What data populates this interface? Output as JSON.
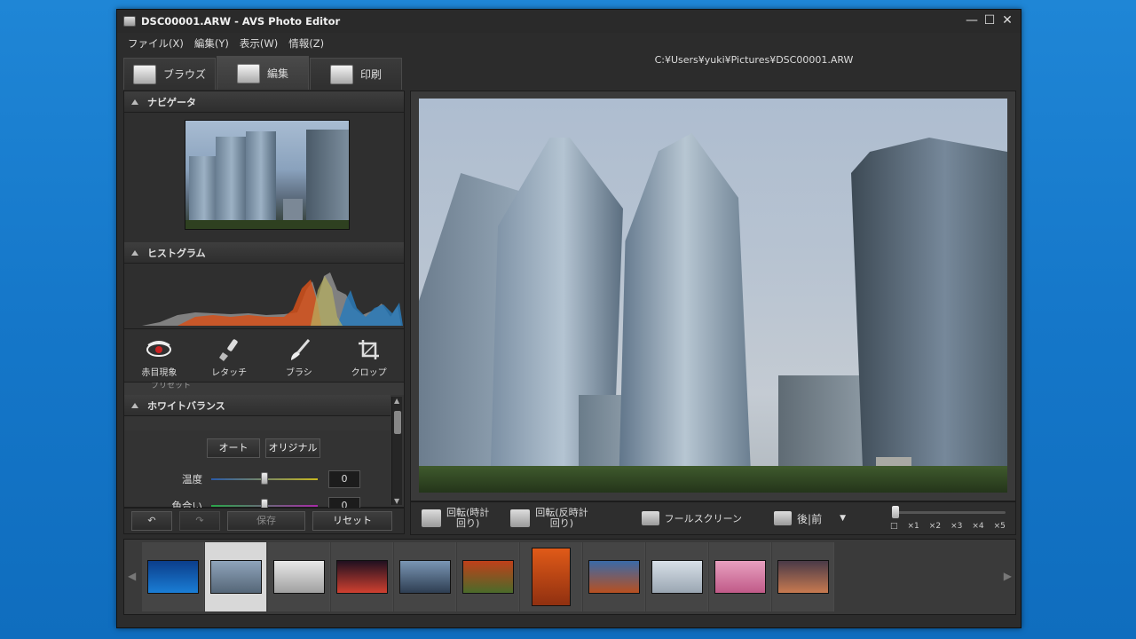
{
  "window": {
    "title": "DSC00001.ARW  -  AVS Photo Editor",
    "controls": [
      "—",
      "☐",
      "✕"
    ]
  },
  "menu": [
    "ファイル(X)",
    "編集(Y)",
    "表示(W)",
    "情報(Z)"
  ],
  "tabs": [
    {
      "label": "ブラウズ",
      "icon": "folder-icon"
    },
    {
      "label": "編集",
      "icon": "edit-icon",
      "active": true
    },
    {
      "label": "印刷",
      "icon": "printer-icon"
    }
  ],
  "file_path": "C:¥Users¥yuki¥Pictures¥DSC00001.ARW",
  "navigator": {
    "title": "ナビゲータ"
  },
  "histogram": {
    "title": "ヒストグラム"
  },
  "tools": [
    {
      "label": "赤目現象",
      "icon": "eye-icon"
    },
    {
      "label": "レタッチ",
      "icon": "retouch-brush-icon"
    },
    {
      "label": "ブラシ",
      "icon": "brush-icon"
    },
    {
      "label": "クロップ",
      "icon": "crop-icon"
    }
  ],
  "preset_partial": "プリセット",
  "white_balance": {
    "title": "ホワイトバランス",
    "auto_label": "オート",
    "original_label": "オリジナル",
    "temperature": {
      "label": "温度",
      "value": "0"
    },
    "tint": {
      "label": "色合い",
      "value": "0"
    }
  },
  "left_actions": {
    "save": "保存",
    "reset": "リセット"
  },
  "main_toolbar": {
    "rotate_cw": "回転(時計\n回り)",
    "rotate_ccw": "回転(反時計\n回り)",
    "fullscreen": "フールスクリーン",
    "before_after": "後|前",
    "zoom_labels": [
      "□",
      "×1",
      "×2",
      "×3",
      "×4",
      "×5"
    ]
  },
  "filmstrip": {
    "thumbnails": [
      {
        "name": "windows-wallpaper",
        "colors": [
          "#0b3d8a",
          "#1a7ed6"
        ]
      },
      {
        "name": "skyscrapers",
        "colors": [
          "#8fa4bb",
          "#556677"
        ],
        "selected": true
      },
      {
        "name": "white-sculpture",
        "colors": [
          "#e8e8e8",
          "#a0a0a0"
        ]
      },
      {
        "name": "night-street",
        "colors": [
          "#201020",
          "#d04030"
        ]
      },
      {
        "name": "mountain-clouds",
        "colors": [
          "#7a96b4",
          "#2e3e52"
        ]
      },
      {
        "name": "autumn-temple",
        "colors": [
          "#c0401a",
          "#4a6b2a"
        ]
      },
      {
        "name": "red-maple",
        "colors": [
          "#e05a18",
          "#903010"
        ],
        "tall": true
      },
      {
        "name": "autumn-hills",
        "colors": [
          "#3a6aa8",
          "#b85020"
        ]
      },
      {
        "name": "modern-building",
        "colors": [
          "#d8e0e8",
          "#9aa6b2"
        ]
      },
      {
        "name": "pink-blossoms",
        "colors": [
          "#e8a0c0",
          "#c05a88"
        ]
      },
      {
        "name": "sunset-pier",
        "colors": [
          "#4a3a48",
          "#c87a50"
        ]
      }
    ]
  }
}
